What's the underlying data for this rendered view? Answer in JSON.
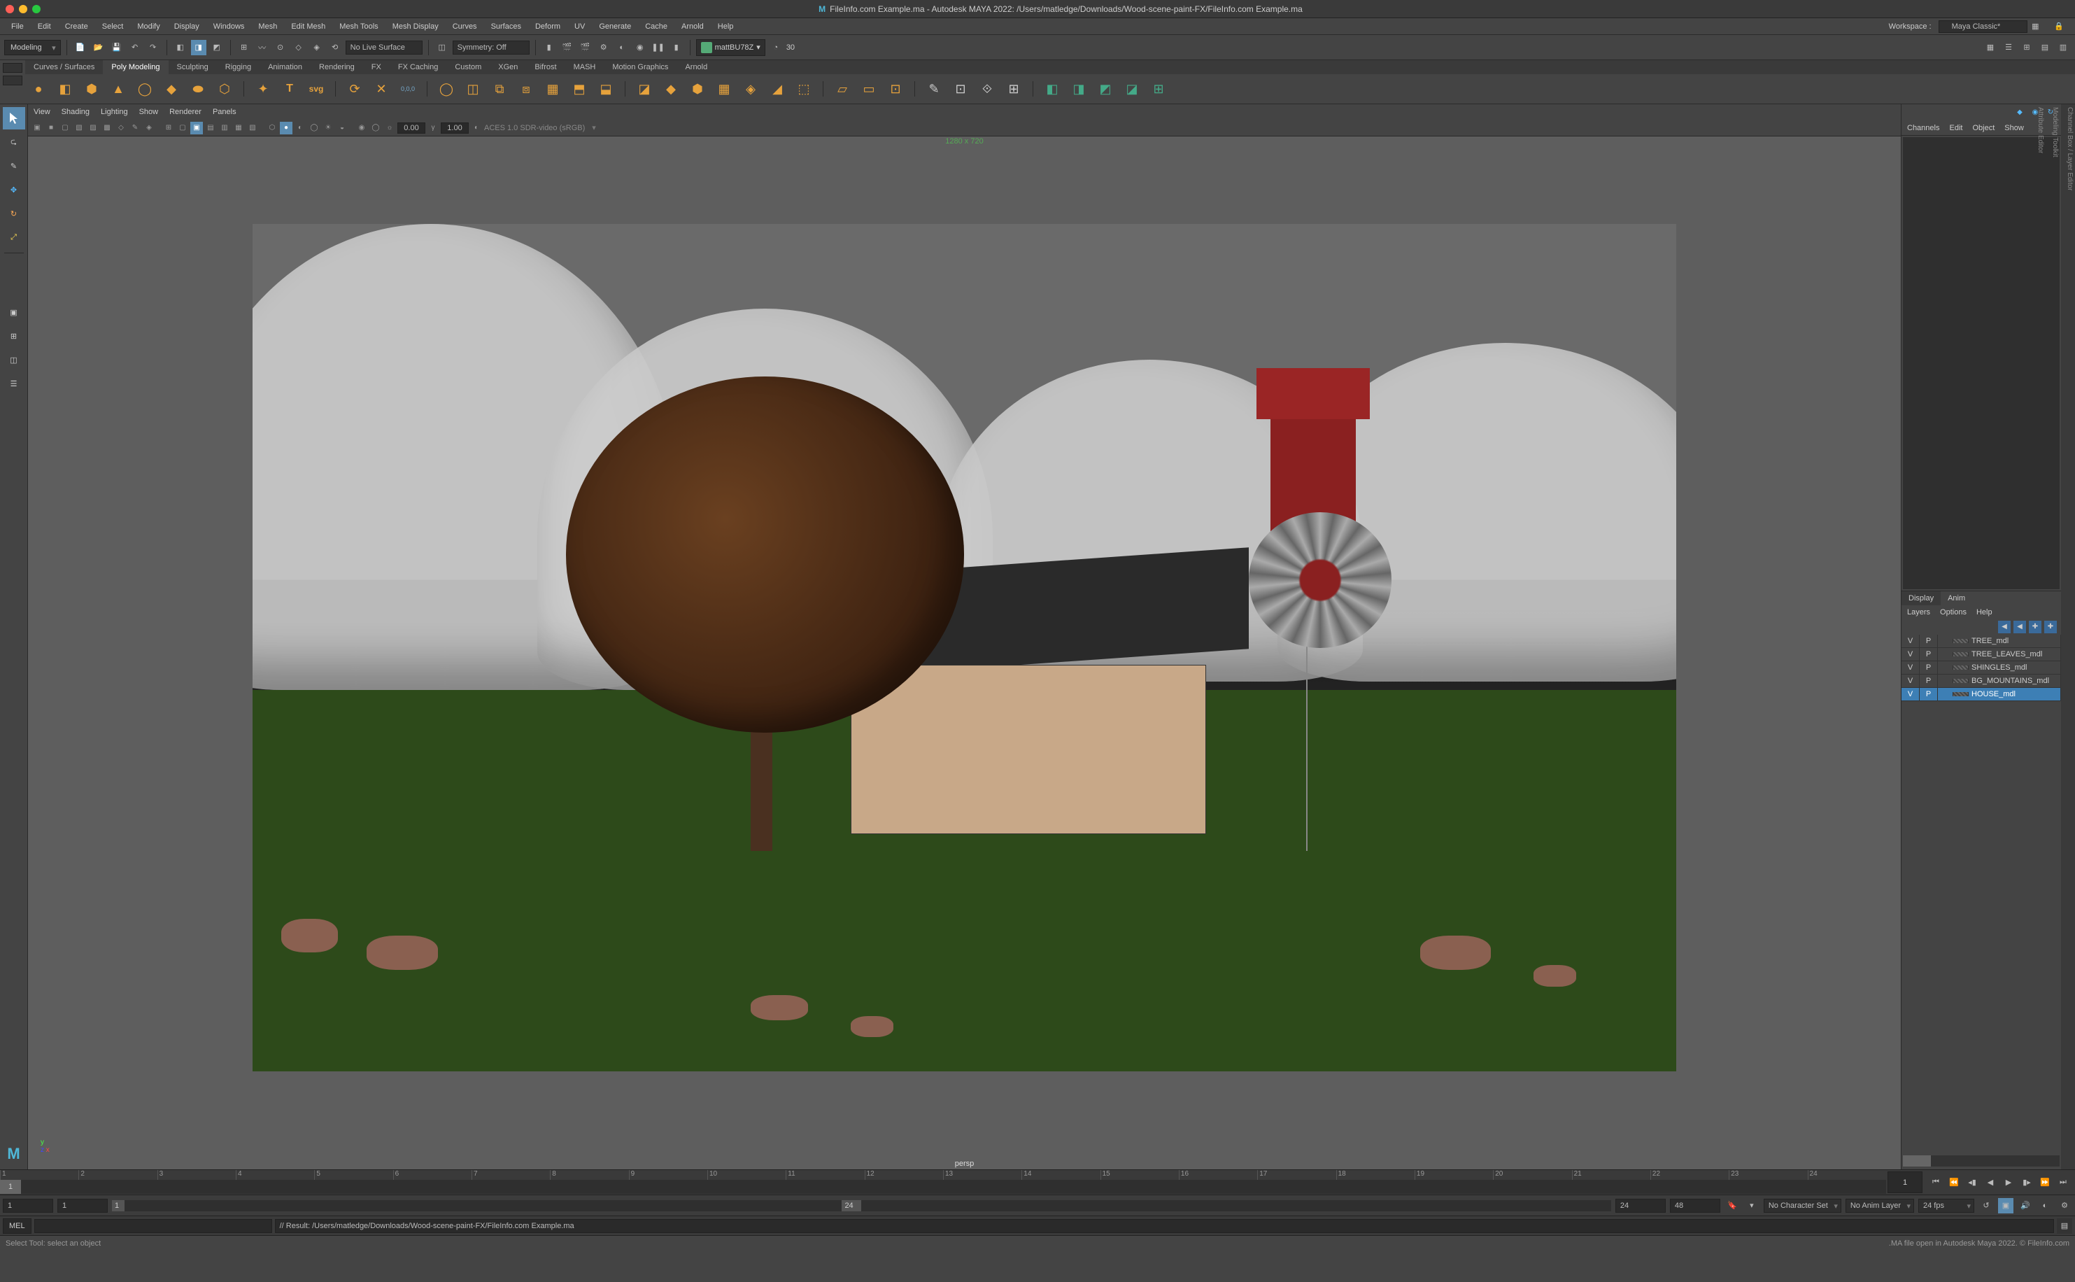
{
  "titlebar": {
    "text": "FileInfo.com Example.ma - Autodesk MAYA 2022: /Users/matledge/Downloads/Wood-scene-paint-FX/FileInfo.com Example.ma"
  },
  "menu": {
    "items": [
      "File",
      "Edit",
      "Create",
      "Select",
      "Modify",
      "Display",
      "Windows",
      "Mesh",
      "Edit Mesh",
      "Mesh Tools",
      "Mesh Display",
      "Curves",
      "Surfaces",
      "Deform",
      "UV",
      "Generate",
      "Cache",
      "Arnold",
      "Help"
    ],
    "workspace_label": "Workspace :",
    "workspace_value": "Maya Classic*"
  },
  "toolbar": {
    "mode": "Modeling",
    "live_surface": "No Live Surface",
    "symmetry": "Symmetry: Off",
    "user": "mattBU78Z",
    "fps_badge": "30"
  },
  "shelf_tabs": [
    "Curves / Surfaces",
    "Poly Modeling",
    "Sculpting",
    "Rigging",
    "Animation",
    "Rendering",
    "FX",
    "FX Caching",
    "Custom",
    "XGen",
    "Bifrost",
    "MASH",
    "Motion Graphics",
    "Arnold"
  ],
  "shelf_active": "Poly Modeling",
  "viewport": {
    "menu": [
      "View",
      "Shading",
      "Lighting",
      "Show",
      "Renderer",
      "Panels"
    ],
    "resolution": "1280 x 720",
    "val1": "0.00",
    "val2": "1.00",
    "colorspace": "ACES 1.0 SDR-video (sRGB)",
    "camera": "persp"
  },
  "channel_box": {
    "tabs": [
      "Channels",
      "Edit",
      "Object",
      "Show"
    ],
    "sub_tabs": [
      "Display",
      "Anim"
    ],
    "sub_menu": [
      "Layers",
      "Options",
      "Help"
    ],
    "side_tabs": [
      "Channel Box / Layer Editor",
      "Modeling Toolkit",
      "Attribute Editor"
    ],
    "layers": [
      {
        "v": "V",
        "p": "P",
        "name": "TREE_mdl",
        "sel": false
      },
      {
        "v": "V",
        "p": "P",
        "name": "TREE_LEAVES_mdl",
        "sel": false
      },
      {
        "v": "V",
        "p": "P",
        "name": "SHINGLES_mdl",
        "sel": false
      },
      {
        "v": "V",
        "p": "P",
        "name": "BG_MOUNTAINS_mdl",
        "sel": false
      },
      {
        "v": "V",
        "p": "P",
        "name": "HOUSE_mdl",
        "sel": true
      }
    ]
  },
  "timeline": {
    "ticks": [
      "1",
      "2",
      "3",
      "4",
      "5",
      "6",
      "7",
      "8",
      "9",
      "10",
      "11",
      "12",
      "13",
      "14",
      "15",
      "16",
      "17",
      "18",
      "19",
      "20",
      "21",
      "22",
      "23",
      "24"
    ],
    "current": "1",
    "end": "1"
  },
  "range": {
    "start_outer": "1",
    "start_inner": "1",
    "val_a": "1",
    "val_b": "24",
    "end_inner": "24",
    "end_outer": "48",
    "char_set": "No Character Set",
    "anim_layer": "No Anim Layer",
    "fps": "24 fps"
  },
  "cmd": {
    "label": "MEL",
    "result": "// Result: /Users/matledge/Downloads/Wood-scene-paint-FX/FileInfo.com Example.ma"
  },
  "status": {
    "left": "Select Tool: select an object",
    "right": ".MA file open in Autodesk Maya 2022. © FileInfo.com"
  }
}
